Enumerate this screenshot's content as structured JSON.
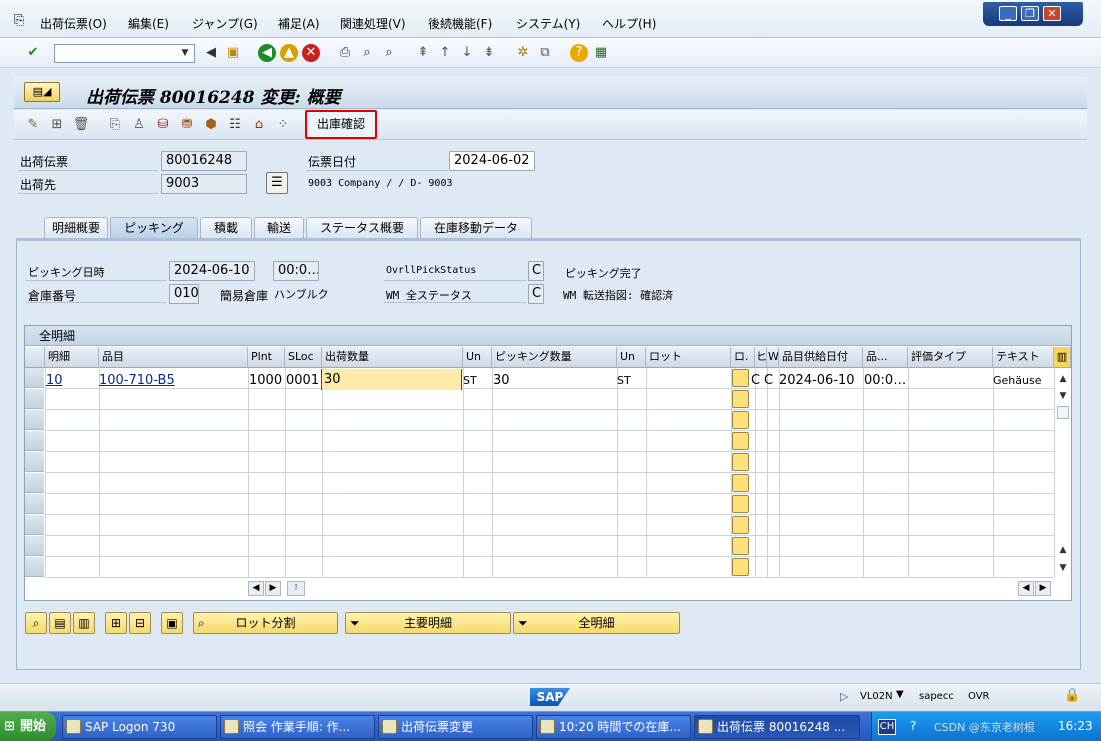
{
  "menu": {
    "items": [
      "出荷伝票(O)",
      "編集(E)",
      "ジャンプ(G)",
      "補足(A)",
      "関連処理(V)",
      "後続機能(F)",
      "システム(Y)",
      "ヘルプ(H)"
    ]
  },
  "window_controls": {
    "minimize": "_",
    "restore": "❐",
    "close": "✕"
  },
  "toolbar": {
    "command_field": ""
  },
  "header": {
    "title": "出荷伝票 80016248 変更: 概要"
  },
  "appbar": {
    "goods_issue_label": "出庫確認"
  },
  "fields": {
    "delivery_label": "出荷伝票",
    "delivery_value": "80016248",
    "shipto_label": "出荷先",
    "shipto_value": "9003",
    "docdate_label": "伝票日付",
    "docdate_value": "2024-06-02",
    "shipto_desc": "9003 Company / / D- 9003"
  },
  "tabs": [
    "明細概要",
    "ピッキング",
    "積載",
    "輸送",
    "ステータス概要",
    "在庫移動データ"
  ],
  "picking": {
    "date_label": "ピッキング日時",
    "date_value": "2024-06-10",
    "time_value": "00:0…",
    "status_label": "OvrllPickStatus",
    "status_value": "C",
    "status_desc": "ピッキング完了",
    "wh_label": "倉庫番号",
    "wh_value": "010",
    "simple_wh_label": "簡易倉庫",
    "simple_wh_desc": "ハンブルク",
    "wm_label": "WM 全ステータス",
    "wm_value": "C",
    "wm_desc": "WM 転送指図: 確認済"
  },
  "grid": {
    "title": "全明細",
    "columns": [
      "明細",
      "品目",
      "Plnt",
      "SLoc",
      "出荷数量",
      "Un",
      "ピッキング数量",
      "Un",
      "ロット",
      "ロ.",
      "ヒ",
      "W.",
      "品目供給日付",
      "品...",
      "評価タイプ",
      "テキスト"
    ],
    "row1": {
      "item": "10",
      "material": "100-710-B5",
      "plant": "1000",
      "sloc": "0001",
      "qty": "30",
      "unit": "ST",
      "pick_qty": "30",
      "pick_unit": "ST",
      "batch": "",
      "h": "C",
      "w": "C",
      "avail_date": "2024-06-10",
      "time": "00:0…",
      "val_type": "",
      "text": "Gehäuse"
    }
  },
  "bottom_buttons": {
    "batch_split": "ロット分割",
    "main_items": "主要明細",
    "all_items": "全明細"
  },
  "status": {
    "sap": "SAP",
    "tcode": "VL02N",
    "server": "sapecc",
    "mode": "OVR"
  },
  "taskbar": {
    "start": "開始",
    "tasks": [
      "SAP Logon 730",
      "照会 作業手順: 作...",
      "出荷伝票変更",
      "10:20 時間での在庫...",
      "出荷伝票 80016248 ..."
    ],
    "lang": "CH",
    "clock": "16:23",
    "watermark": "CSDN @东京老树根"
  },
  "colors": {
    "accent_red": "#e00000",
    "field_yellow": "#ffe07a",
    "sap_blue": "#0a55b0"
  }
}
